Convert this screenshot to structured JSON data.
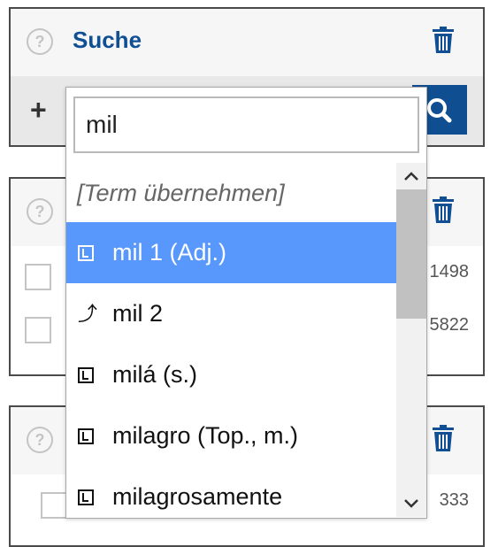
{
  "panels": [
    {
      "title": "Suche"
    },
    {
      "rows": [
        "1498",
        "5822"
      ]
    },
    {
      "rows": [
        "333"
      ]
    }
  ],
  "dropdown": {
    "input_value": "mil",
    "items": [
      {
        "icon": "none",
        "label": "[Term übernehmen]",
        "placeholder": true
      },
      {
        "icon": "lemma-icon",
        "label": "mil 1 (Adj.)",
        "selected": true
      },
      {
        "icon": "redirect-icon",
        "label": "mil 2"
      },
      {
        "icon": "lemma-icon",
        "label": "milá (s.)"
      },
      {
        "icon": "lemma-icon",
        "label": "milagro (Top., m.)"
      },
      {
        "icon": "lemma-icon",
        "label": "milagrosamente"
      }
    ]
  },
  "colors": {
    "accent": "#114f94",
    "selected": "#5897fb",
    "toolbar": "#e8e8e8",
    "header": "#f6f6f6"
  }
}
